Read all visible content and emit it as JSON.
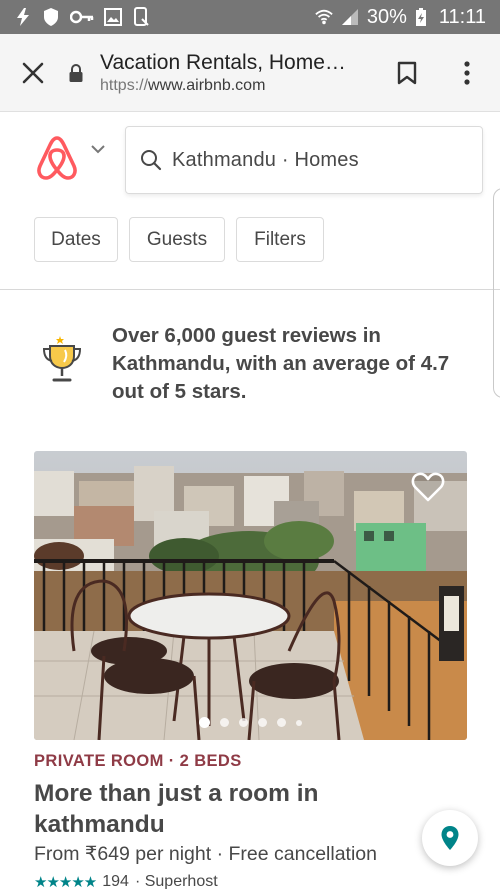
{
  "status_bar": {
    "battery": "30%",
    "time": "11:11",
    "icons": [
      "flash-icon",
      "shield-icon",
      "key-icon",
      "image-icon",
      "phone-icon",
      "wifi-icon",
      "signal-icon",
      "battery-icon"
    ]
  },
  "browser": {
    "page_title": "Vacation Rentals, Home…",
    "url_scheme": "https://",
    "url_host": "www.airbnb.com",
    "icons": [
      "close-icon",
      "lock-icon",
      "bookmark-icon",
      "more-vert-icon"
    ]
  },
  "header": {
    "logo": "airbnb-logo",
    "search_text": "Kathmandu · Homes",
    "filters": [
      "Dates",
      "Guests",
      "Filters"
    ]
  },
  "review_banner": {
    "text": "Over 6,000 guest reviews in Kathmandu, with an average of 4.7 out of 5 stars.",
    "icon": "trophy-icon"
  },
  "listing": {
    "kicker": "PRIVATE ROOM · 2 BEDS",
    "title": "More than just a room in kathmandu",
    "price": "From ₹649 per night · Free cancellation",
    "stars": "★★★★★",
    "review_count": "194",
    "badge": "· Superhost",
    "photo_count_dots": 6,
    "active_photo": 1
  },
  "colors": {
    "brand": "#FF5A5F",
    "kicker": "#8F3B46",
    "teal": "#008489",
    "status_bar": "#767676"
  }
}
